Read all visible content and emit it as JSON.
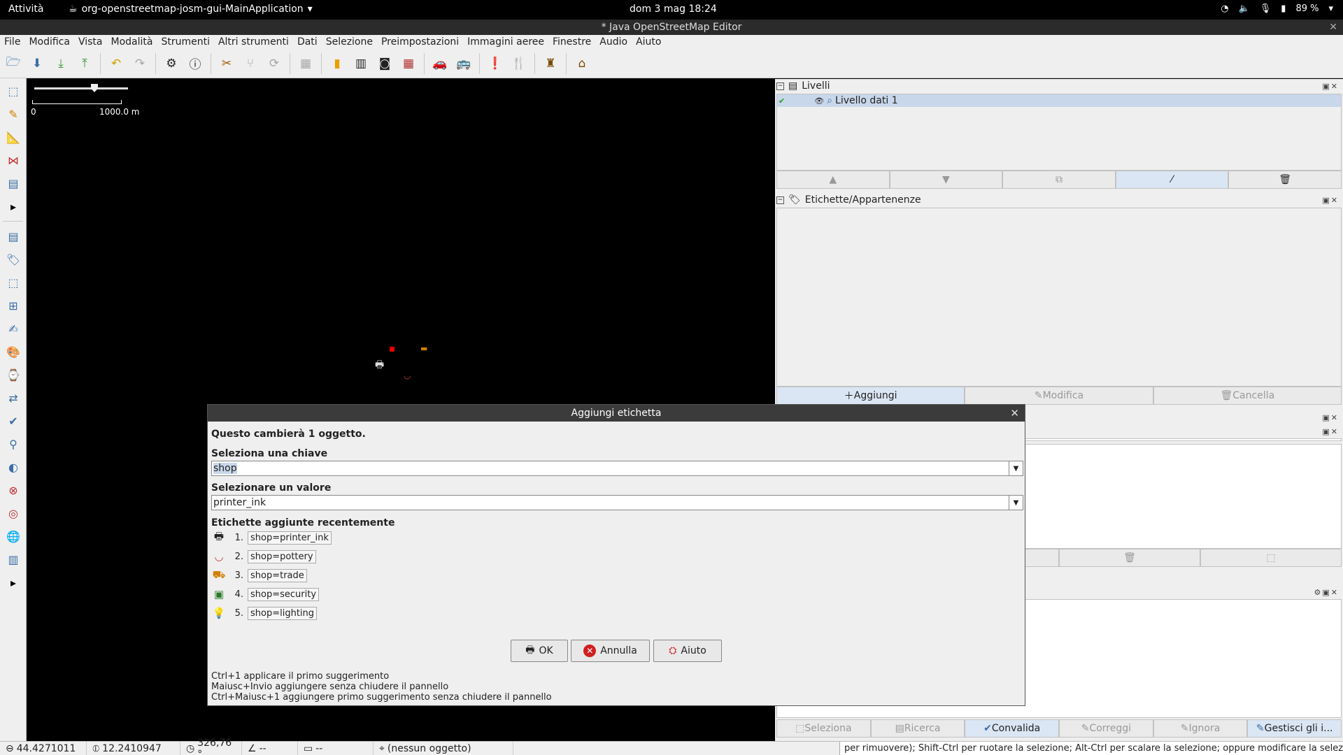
{
  "gnome": {
    "activities": "Attività",
    "app_name": "org-openstreetmap-josm-gui-MainApplication",
    "clock": "dom 3 mag  18:24",
    "battery": "89 %"
  },
  "window": {
    "title": "* Java OpenStreetMap Editor"
  },
  "menu": [
    "File",
    "Modifica",
    "Vista",
    "Modalità",
    "Strumenti",
    "Altri strumenti",
    "Dati",
    "Selezione",
    "Preimpostazioni",
    "Immagini aeree",
    "Finestre",
    "Audio",
    "Aiuto"
  ],
  "map": {
    "scale_zero": "0",
    "scale_max": "1000.0 m",
    "zoom_level": 0.62
  },
  "panels": {
    "layers": {
      "title": "Livelli",
      "layer_name": "Livello dati 1"
    },
    "tags": {
      "title": "Etichette/Appartenenze",
      "add": "Aggiungi",
      "edit": "Modifica",
      "delete": "Cancella"
    },
    "validation": {
      "select": "Seleziona",
      "search": "Ricerca",
      "validate": "Convalida",
      "fix": "Correggi",
      "ignore": "Ignora",
      "manage": "Gestisci gli i..."
    }
  },
  "dialog": {
    "title": "Aggiungi etichetta",
    "info": "Questo cambierà 1 oggetto.",
    "key_label": "Seleziona una chiave",
    "key_value": "shop",
    "value_label": "Selezionare un valore",
    "value_value": "printer_ink",
    "recent_label": "Etichette aggiunte recentemente",
    "recent": [
      {
        "num": "1.",
        "tag": "shop=printer_ink",
        "icon": "printer-icon"
      },
      {
        "num": "2.",
        "tag": "shop=pottery",
        "icon": "pottery-icon"
      },
      {
        "num": "3.",
        "tag": "shop=trade",
        "icon": "forklift-icon"
      },
      {
        "num": "4.",
        "tag": "shop=security",
        "icon": "security-icon"
      },
      {
        "num": "5.",
        "tag": "shop=lighting",
        "icon": "lamp-icon"
      }
    ],
    "ok": "OK",
    "cancel": "Annulla",
    "help": "Aiuto",
    "hints": [
      "Ctrl+1 applicare il primo suggerimento",
      "Maiusc+Invio aggiungere senza chiudere il pannello",
      "Ctrl+Maiusc+1 aggiungere primo suggerimento senza chiudere il pannello"
    ]
  },
  "status": {
    "lat": "44.4271011",
    "lon": "12.2410947",
    "heading": "326,76 °",
    "angle": "--",
    "distance": "--",
    "object": "(nessun oggetto)",
    "message": "per rimuovere); Shift-Ctrl per ruotare la selezione; Alt-Ctrl per scalare la selezione; oppure modificare la selezione"
  }
}
